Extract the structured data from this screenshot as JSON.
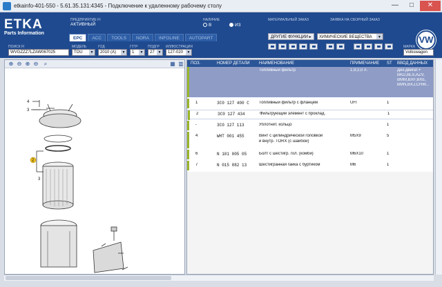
{
  "window": {
    "title": "etkainfo-401-550 - 5.61.35.131:4345 - Подключение к удаленному рабочему столу",
    "min": "—",
    "max": "□",
    "close": "✕"
  },
  "header": {
    "logo_big": "ETKA",
    "logo_small": "Parts Information",
    "predpr_label": "ПРЕДПРИЯТИЕ FI",
    "predpr_value": "АКТИВНЫЙ",
    "nalichie_label": "НАЛИЧИЕ",
    "radio_b": "В",
    "radio_iz": "ИЗ",
    "material_label": "МАТЕРИАЛЬНЫЙ ЗАКАЗ",
    "zayavka_label": "ЗАЯВКА НА СБОРНЫЙ ЗАКАЗ",
    "tabs": [
      "EPC",
      "ACC",
      "TOOLS",
      "NORA",
      "INFOLINE",
      "AUTOPART"
    ],
    "func_button": "ДРУГИЕ ФУНКЦИИ ▸",
    "func_select": "ХИМИЧЕСКИЕ ВЕЩЕСТВА",
    "fields": {
      "poisk_label": "ПОИСК FI",
      "poisk_value": "WVGZZZ7LZAW067025",
      "model_label": "МОДЕЛЬ",
      "model_value": "TOU",
      "god_label": "ГОД",
      "god_value": "2010 (A)",
      "ggr_label": "ГГГР",
      "ggr_value": "1",
      "podgr_label": "ПОДГР",
      "podgr_value": "27",
      "illus_label": "ИЛЛЮСТРАЦИЯ",
      "illus_value": "127-020",
      "marka_label": "МАРКА",
      "marka_value": "Volkswagen"
    },
    "vw": "VW"
  },
  "table": {
    "headers": [
      "ПОЗ.",
      "НОМЕР ДЕТАЛИ",
      "НАИМЕНОВАНИЕ",
      "ПРИМЕЧАНИЕ",
      "ST",
      "ВВОД ДАННЫХ"
    ],
    "group": {
      "name": "Топливный фильтр",
      "note": "1,9;2,0 л.",
      "data1": "Диз.двигат.+",
      "data2": "BKD,BLS,AZV,",
      "data3": "BMM,BXF,BXE,",
      "data4": "BMN,BXJ,CHW..."
    },
    "rows": [
      {
        "pos": "1",
        "part": "3C0  127  400  C",
        "name": "Топливный фильтр с фланцем",
        "name2": "",
        "note": "UFI",
        "st": "1"
      },
      {
        "pos": "2",
        "part": "3C0  127  434",
        "name": "Фильтрующий элемент с проклад.",
        "name2": "",
        "note": "",
        "st": "1"
      },
      {
        "pos": "-",
        "part": "3C0  127  113",
        "name": "Уплотнит. кольцо",
        "name2": "",
        "note": "",
        "st": "1"
      },
      {
        "pos": "4",
        "part": "WHT  001  455",
        "name": "Винт с цилиндрической головкой",
        "name2": "и внутр. TORX (с шайбой)",
        "note": "M5X9",
        "st": "5"
      },
      {
        "pos": "6",
        "part": "N     101  005  05",
        "name": "Болт с шестигр. гол. (комби)",
        "name2": "",
        "note": "M6X10",
        "st": "1"
      },
      {
        "pos": "7",
        "part": "N     015  082  13",
        "name": "Шестигранная гайка с буртиком",
        "name2": "",
        "note": "M6",
        "st": "1"
      }
    ]
  },
  "diagram": {
    "callouts": [
      "4",
      "3",
      "2",
      "3"
    ]
  }
}
